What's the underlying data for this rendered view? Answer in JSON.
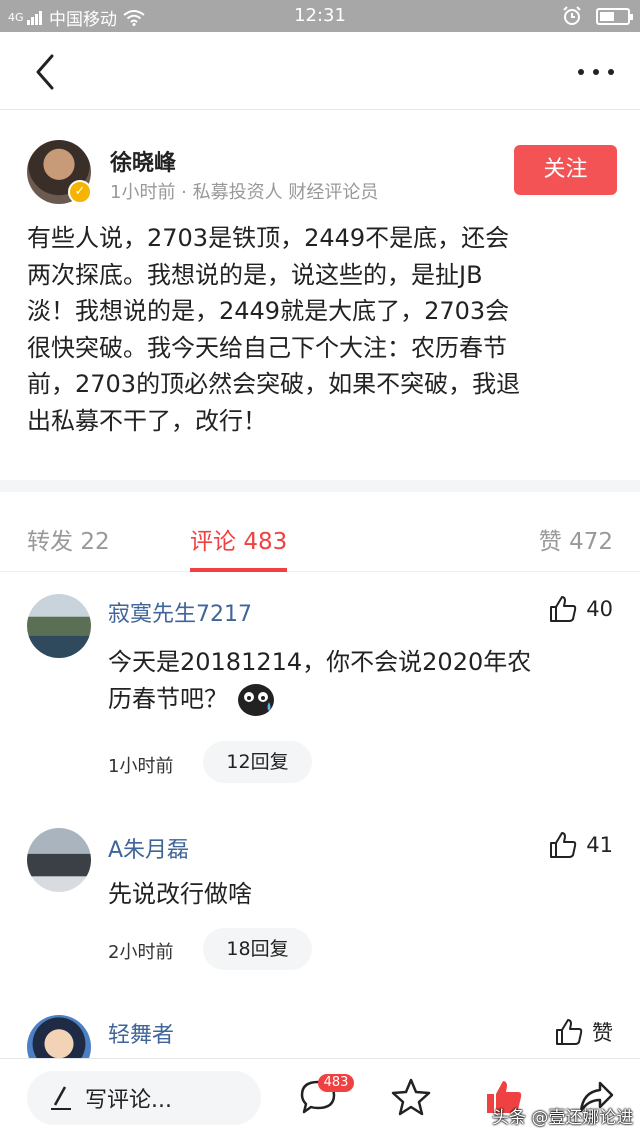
{
  "status_bar": {
    "signal": "4G",
    "carrier": "中国移动",
    "time": "12:31"
  },
  "nav": {
    "back_icon": "chevron-left-icon",
    "more_icon": "more-dots-icon"
  },
  "author": {
    "name": "徐晓峰",
    "meta": "1小时前 · 私募投资人 财经评论员",
    "follow_label": "关注"
  },
  "post": {
    "lines": [
      "有些人说，2703是铁顶，2449不是底，还会",
      "两次探底。我想说的是，说这些的，是扯JB",
      "淡！我想说的是，2449就是大底了，2703会",
      "很快突破。我今天给自己下个大注：农历春节",
      "前，2703的顶必然会突破，如果不突破，我退",
      "出私募不干了，改行！"
    ]
  },
  "tabs": {
    "repost": {
      "label": "转发",
      "count": "22"
    },
    "comments": {
      "label": "评论",
      "count": "483"
    },
    "likes": {
      "label": "赞",
      "count": "472"
    }
  },
  "comments": [
    {
      "name": "寂寞先生7217",
      "likes": "40",
      "text_lines": [
        "今天是20181214，你不会说2020年农",
        "历春节吧？"
      ],
      "time": "1小时前",
      "replies": "12回复"
    },
    {
      "name": "A朱月磊",
      "likes": "41",
      "text_lines": [
        "先说改行做啥"
      ],
      "time": "2小时前",
      "replies": "18回复"
    },
    {
      "name": "轻舞者",
      "likes": "赞"
    }
  ],
  "bottom_bar": {
    "input_placeholder": "写评论...",
    "comment_badge": "483",
    "watermark": "头条 @壹还娜论进"
  },
  "colors": {
    "accent": "#f04142",
    "follow_bg": "#f35354",
    "link_name": "#406599"
  }
}
